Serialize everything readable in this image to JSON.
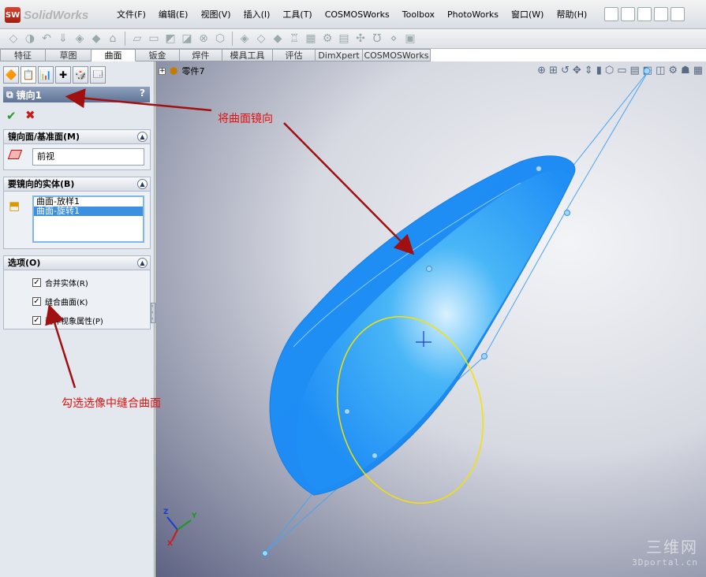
{
  "app": {
    "title": "SolidWorks",
    "logo_text": "SW"
  },
  "menu": [
    "文件(F)",
    "编辑(E)",
    "视图(V)",
    "插入(I)",
    "工具(T)",
    "COSMOSWorks",
    "Toolbox",
    "PhotoWorks",
    "窗口(W)",
    "帮助(H)"
  ],
  "command_tabs": [
    "特征",
    "草图",
    "曲面",
    "钣金",
    "焊件",
    "模具工具",
    "评估",
    "DimXpert",
    "COSMOSWorks"
  ],
  "active_command_tab": "曲面",
  "property_manager": {
    "title": "镜向1",
    "help": "?",
    "ok_symbol": "✔",
    "cancel_symbol": "✖",
    "mirror_face": {
      "label": "镜向面/基准面(M)",
      "value": "前视"
    },
    "bodies": {
      "label": "要镜向的实体(B)",
      "items": [
        "曲面-放样1",
        "曲面-旋转1"
      ],
      "selected_index": 1
    },
    "options": {
      "label": "选项(O)",
      "items": [
        {
          "label": "合并实体(R)",
          "checked": true
        },
        {
          "label": "缝合曲面(K)",
          "checked": true
        },
        {
          "label": "延伸视象属性(P)",
          "checked": true
        }
      ]
    }
  },
  "viewport": {
    "tree_label": "零件7"
  },
  "annotations": {
    "mirror_note": "将曲面镜向",
    "knit_note": "勾选选像中缝合曲面"
  },
  "triad": {
    "x": "X",
    "y": "Y",
    "z": "Z"
  },
  "watermark": {
    "line1": "三维网",
    "line2": "3Dportal.cn"
  },
  "colors": {
    "surface": "#1f8ef5",
    "annotation": "#e0120e",
    "arrow": "#a01010",
    "curve": "#f5e100"
  }
}
